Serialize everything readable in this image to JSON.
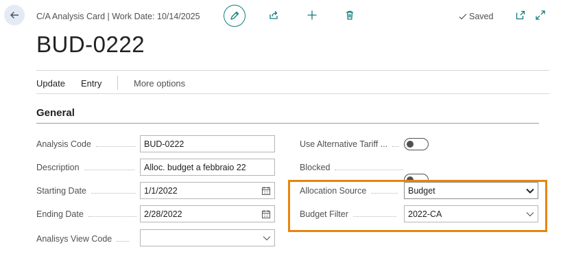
{
  "header": {
    "breadcrumb": "C/A Analysis Card | Work Date: 10/14/2025",
    "saved_label": "Saved",
    "icons": [
      "back-arrow-icon",
      "edit-pencil-icon",
      "share-icon",
      "plus-icon",
      "delete-icon",
      "checkmark-icon",
      "open-new-window-icon",
      "expand-icon"
    ]
  },
  "page": {
    "title": "BUD-0222"
  },
  "actions": {
    "update": "Update",
    "entry": "Entry",
    "more": "More options"
  },
  "general": {
    "title": "General",
    "analysis_code": {
      "label": "Analysis Code",
      "value": "BUD-0222"
    },
    "description": {
      "label": "Description",
      "value": "Alloc. budget a febbraio 22"
    },
    "starting_date": {
      "label": "Starting Date",
      "value": "1/1/2022"
    },
    "ending_date": {
      "label": "Ending Date",
      "value": "2/28/2022"
    },
    "analysis_view_code": {
      "label": "Analisys View Code",
      "value": ""
    },
    "use_alt_tariff": {
      "label": "Use Alternative Tariff ...",
      "on": false
    },
    "blocked": {
      "label": "Blocked",
      "on": false
    },
    "allocation_source": {
      "label": "Allocation Source",
      "value": "Budget"
    },
    "budget_filter": {
      "label": "Budget Filter",
      "value": "2022-CA"
    }
  },
  "colors": {
    "accent": "#0f7b7b",
    "highlight": "#e8850c",
    "back_button_bg": "#e3ebf4"
  }
}
